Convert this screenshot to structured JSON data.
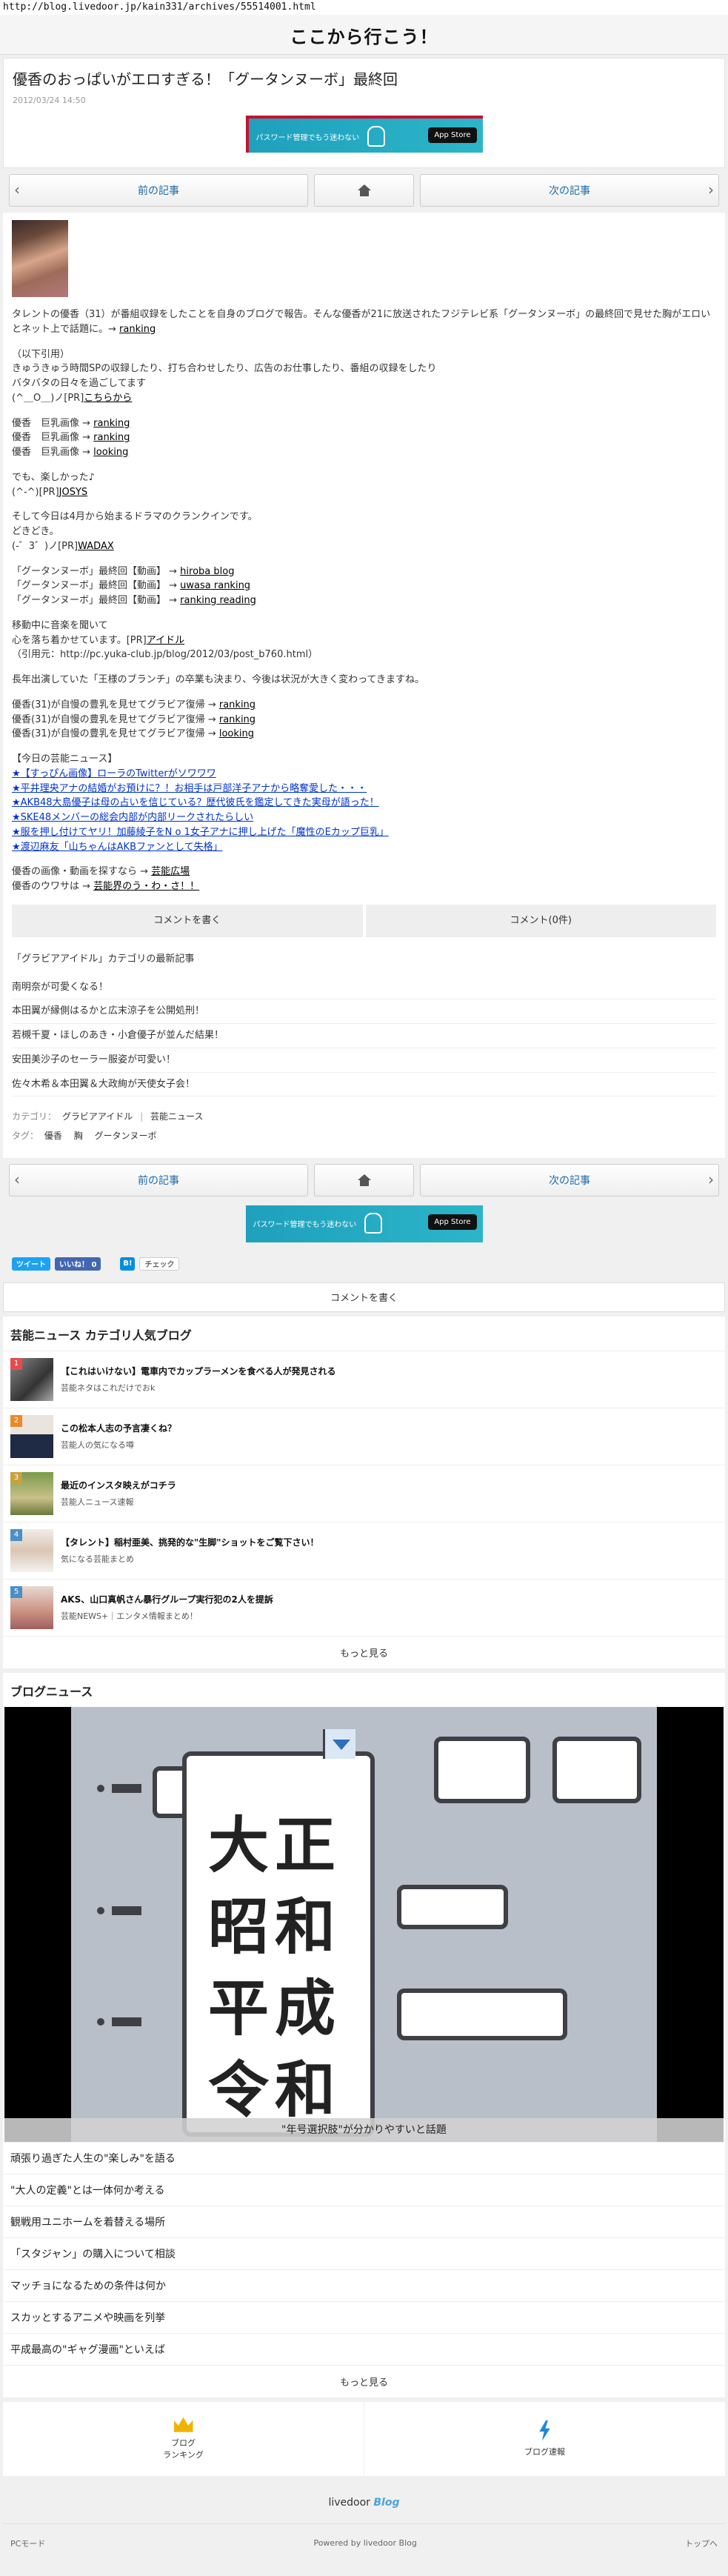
{
  "url": "http://blog.livedoor.jp/kain331/archives/55514001.html",
  "site_title": "ここから行こう！",
  "article": {
    "title": "優香のおっぱいがエロすぎる！「グータンヌーボ」最終回",
    "date": "2012/03/24 14:50"
  },
  "banner": {
    "text": "パスワード管理でもう迷わない",
    "store": "App Store"
  },
  "pager": {
    "prev": "前の記事",
    "next": "次の記事"
  },
  "body": {
    "intro": "タレントの優香（31）が番組収録をしたことを自身のブログで報告。そんな優香が21に放送されたフジテレビ系「グータンヌーボ」の最終回で見せた胸がエロいとネット上で話題に。→",
    "intro_link": "ranking",
    "quote_lines": [
      "（以下引用）",
      "きゅうきゅう時間SPの収録したり、打ち合わせしたり、広告のお仕事したり、番組の収録をしたり",
      "バタバタの日々を過ごしてます",
      "(^＿O＿)ノ[PR]"
    ],
    "quote_link": "こちらから",
    "kyonyu": [
      {
        "label": "優香　巨乳画像 →",
        "link": "ranking"
      },
      {
        "label": "優香　巨乳画像 →",
        "link": "ranking"
      },
      {
        "label": "優香　巨乳画像 →",
        "link": "looking"
      }
    ],
    "p3_line1": "でも、楽しかった♪",
    "p3_line2": "(^-^)[PR]",
    "p3_link": "JOSYS",
    "p4_line1": "そして今日は4月から始まるドラマのクランクインです。",
    "p4_line2": "どきどき。",
    "p4_line3": "(-゛3゛)ノ[PR]",
    "p4_link": "WADAX",
    "videos": [
      {
        "label": "「グータンヌーボ」最終回【動画】 →",
        "links": [
          "hiroba",
          " blog"
        ]
      },
      {
        "label": "「グータンヌーボ」最終回【動画】 →",
        "links": [
          "uwasa",
          " ranking"
        ]
      },
      {
        "label": "「グータンヌーボ」最終回【動画】 →",
        "links": [
          "ranking",
          " reading"
        ]
      }
    ],
    "p6_line1": "移動中に音楽を聞いて",
    "p6_line2": "心を落ち着かせています。[PR]",
    "p6_link": "アイドル",
    "p6_line3": "（引用元：http://pc.yuka-club.jp/blog/2012/03/post_b760.html）",
    "p7": "長年出演していた「王様のブランチ」の卒業も決まり、今後は状況が大きく変わってきますね。",
    "fukkatsu": [
      {
        "label": "優香(31)が自慢の豊乳を見せてグラビア復帰 →",
        "link": "ranking"
      },
      {
        "label": "優香(31)が自慢の豊乳を見せてグラビア復帰 →",
        "link": "ranking"
      },
      {
        "label": "優香(31)が自慢の豊乳を見せてグラビア復帰 →",
        "link": "looking"
      }
    ],
    "today_head": "【今日の芸能ニュース】",
    "today_items": [
      "★【すっぴん画像】ローラのTwitterがソワワワ",
      "★平井理央アナの結婚がお預けに？！お相手は戸部洋子アナから略奪愛した・・・",
      "★AKB48大島優子は母の占いを信じている？歴代彼氏を鑑定してきた実母が語った！",
      "★SKE48メンバーの総会内部が内部リークされたらしい",
      "★服を押し付けてヤリ！加藤綾子をN o 1女子アナに押し上げた「魔性のEカップ巨乳」",
      "★渡辺麻友「山ちゃんはAKBファンとして失格」"
    ],
    "closing": [
      {
        "label": "優香の画像・動画を探すなら →",
        "link": "芸能広場"
      },
      {
        "label": "優香のウワサは →",
        "link": "芸能界のう・わ・さ！！"
      }
    ]
  },
  "buttons": {
    "write_comment": "コメントを書く",
    "comment_count": "コメント(0件)"
  },
  "category": {
    "title": "「グラビアアイドル」カテゴリの最新記事",
    "items": [
      "南明奈が可愛くなる！",
      "本田翼が縁側はるかと広末涼子を公開処刑！",
      "若槻千夏・ほしのあき・小倉優子が並んだ結果！",
      "安田美沙子のセーラー服姿が可愛い！",
      "佐々木希＆本田翼＆大政絢が天使女子会！"
    ]
  },
  "meta": {
    "category_label": "カテゴリ：",
    "categories": [
      "グラビアアイドル",
      "芸能ニュース"
    ],
    "tag_label": "タグ：",
    "tags": [
      "優香",
      "胸",
      "グータンヌーボ"
    ]
  },
  "social": {
    "tweet": "ツイート",
    "like": "いいね！ 0",
    "hatena": "B!",
    "check": "チェック"
  },
  "comment_bar": "コメントを書く",
  "popular": {
    "title": "芸能ニュース カテゴリ人気ブログ",
    "items": [
      {
        "num": "1",
        "title": "【これはいけない】電車内でカップラーメンを食べる人が発見される",
        "source": "芸能ネタはこれだけでおk"
      },
      {
        "num": "2",
        "title": "この松本人志の予言凄くね？",
        "source": "芸能人の気になる噂"
      },
      {
        "num": "3",
        "title": "最近のインスタ映えがコチラ",
        "source": "芸能人ニュース速報"
      },
      {
        "num": "4",
        "title": "【タレント】稲村亜美、挑発的な\"生脚\"ショットをご覧下さい！",
        "source": "気になる芸能まとめ"
      },
      {
        "num": "5",
        "title": "AKS、山口真帆さん暴行グループ実行犯の2人を提訴",
        "source": "芸能NEWS+｜エンタメ情報まとめ！"
      }
    ],
    "more": "もっと見る"
  },
  "blog_news": {
    "title": "ブログニュース",
    "photo_eras": [
      "大正",
      "昭和",
      "平成",
      "令和"
    ],
    "photo_caption": "\"年号選択肢\"が分かりやすいと話題",
    "items": [
      "頑張り過ぎた人生の\"楽しみ\"を語る",
      "\"大人の定義\"とは一体何か考える",
      "観戦用ユニホームを着替える場所",
      "「スタジャン」の購入について相談",
      "マッチョになるための条件は何か",
      "スカッとするアニメや映画を列挙",
      "平成最高の\"ギャグ漫画\"といえば"
    ],
    "more": "もっと見る"
  },
  "footer_nav": {
    "ranking": "ブログ\nランキング",
    "sokuhou": "ブログ速報"
  },
  "logo": {
    "livedoor": "livedoor",
    "blog": "Blog"
  },
  "bottom": {
    "pc_mode": "PCモード",
    "powered": "Powered by livedoor Blog",
    "top": "トップへ"
  },
  "colors": {
    "link_blue": "#0033cc",
    "banner": "#1fa0bd",
    "rank_badge": "#e54b4b"
  }
}
